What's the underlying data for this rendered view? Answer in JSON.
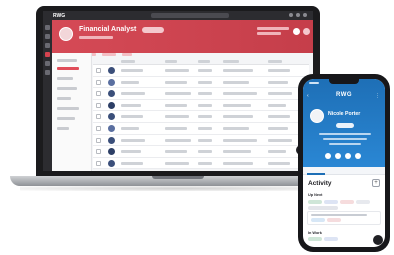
{
  "laptop": {
    "brand": "RWG",
    "header_title": "Financial Analyst",
    "accent_color": "#d54a56"
  },
  "phone": {
    "brand": "RWG",
    "back_icon": "back-arrow-icon",
    "menu_icon": "more-icon",
    "candidate_name": "Nicole Porter",
    "activity_heading": "Activity",
    "add_icon": "+",
    "section_1": "Up Next",
    "section_2": "In Work",
    "accent_color": "#1e6fb6"
  }
}
